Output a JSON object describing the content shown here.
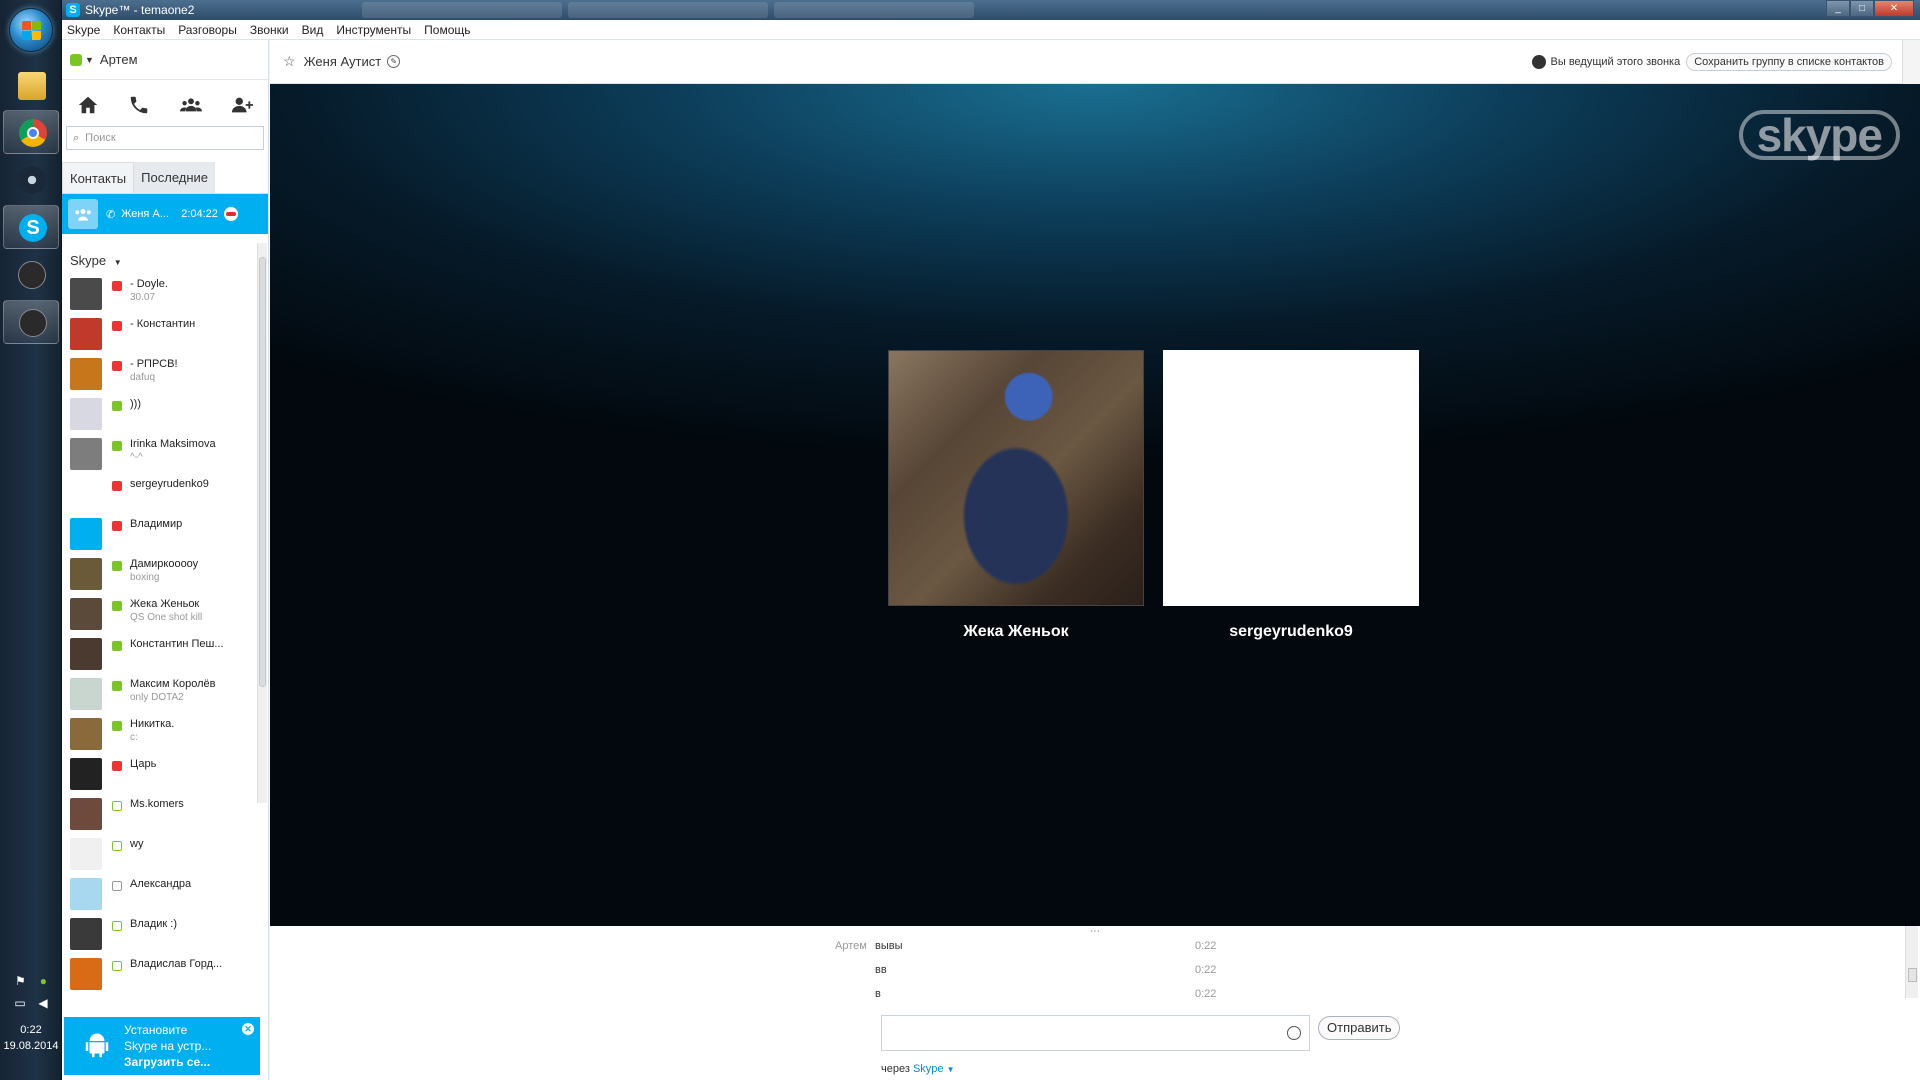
{
  "window": {
    "title": "Skype™ - temaone2"
  },
  "menu": [
    "Skype",
    "Контакты",
    "Разговоры",
    "Звонки",
    "Вид",
    "Инструменты",
    "Помощь"
  ],
  "profile": {
    "name": "Артем",
    "status": "online"
  },
  "search": {
    "placeholder": "Поиск"
  },
  "tabs": {
    "contacts": "Контакты",
    "recent": "Последние"
  },
  "active_call": {
    "name": "Женя А...",
    "duration": "2:04:22"
  },
  "group": {
    "label": "Skype"
  },
  "contacts": [
    {
      "name": "- Doyle.",
      "sub": "30.07",
      "status": "busy",
      "color": "#4a4a4a"
    },
    {
      "name": "- Константин",
      "sub": "",
      "status": "busy",
      "color": "#c0392b"
    },
    {
      "name": "- РПРСВ!",
      "sub": "dafuq",
      "status": "busy",
      "color": "#c7761b"
    },
    {
      "name": ")))",
      "sub": "",
      "status": "online",
      "color": "#d8d8e2"
    },
    {
      "name": "Irinka Maksimova",
      "sub": "^-^",
      "status": "online",
      "color": "#7d7d7d"
    },
    {
      "name": "sergeyrudenko9",
      "sub": "",
      "status": "busy",
      "color": "#ffffff"
    },
    {
      "name": "Владимир",
      "sub": "",
      "status": "busy",
      "color": "#00aff0"
    },
    {
      "name": "Дамиркооооу",
      "sub": "boxing",
      "status": "online",
      "color": "#6a5a3a"
    },
    {
      "name": "Жека Женьок",
      "sub": "QS One shot kill",
      "status": "online",
      "color": "#5b4a3a"
    },
    {
      "name": "Константин Пеш...",
      "sub": "",
      "status": "online",
      "color": "#4b3a30"
    },
    {
      "name": "Максим Королёв",
      "sub": "only DOTA2",
      "status": "online",
      "color": "#c9d6d0"
    },
    {
      "name": "Никитка.",
      "sub": "c:",
      "status": "online",
      "color": "#8a6a3a"
    },
    {
      "name": "Царь",
      "sub": "",
      "status": "busy",
      "color": "#222222"
    },
    {
      "name": "Ms.komers",
      "sub": "",
      "status": "offline",
      "color": "#6e4a3c"
    },
    {
      "name": "wy",
      "sub": "",
      "status": "offline",
      "color": "#f0f0f0"
    },
    {
      "name": "Александра",
      "sub": "",
      "status": "unknown",
      "color": "#a8d8ef"
    },
    {
      "name": "Владик :)",
      "sub": "",
      "status": "offline",
      "color": "#3a3a3a"
    },
    {
      "name": "Владислав Горд...",
      "sub": "",
      "status": "offline",
      "color": "#d96a16"
    }
  ],
  "promo": {
    "line1": "Установите",
    "line2": "Skype на устр...",
    "line3": "Загрузить се..."
  },
  "conversation": {
    "title": "Женя Аутист",
    "host_text": "Вы ведущий этого звонка",
    "save_group": "Сохранить группу в списке контактов"
  },
  "stage": {
    "logo": "skype",
    "participants": [
      {
        "name": "Жека Женьок"
      },
      {
        "name": "sergeyrudenko9"
      }
    ]
  },
  "chat": {
    "messages": [
      {
        "author": "Артем",
        "text": "вывы",
        "time": "0:22"
      },
      {
        "author": "",
        "text": "вв",
        "time": "0:22"
      },
      {
        "author": "",
        "text": "в",
        "time": "0:22"
      }
    ],
    "send_label": "Отправить",
    "via_prefix": "через",
    "via_link": "Skype"
  },
  "tray": {
    "time": "0:22",
    "date": "19.08.2014"
  },
  "colors": {
    "accent": "#00aff0",
    "online": "#7cc623",
    "busy": "#ee3333"
  }
}
